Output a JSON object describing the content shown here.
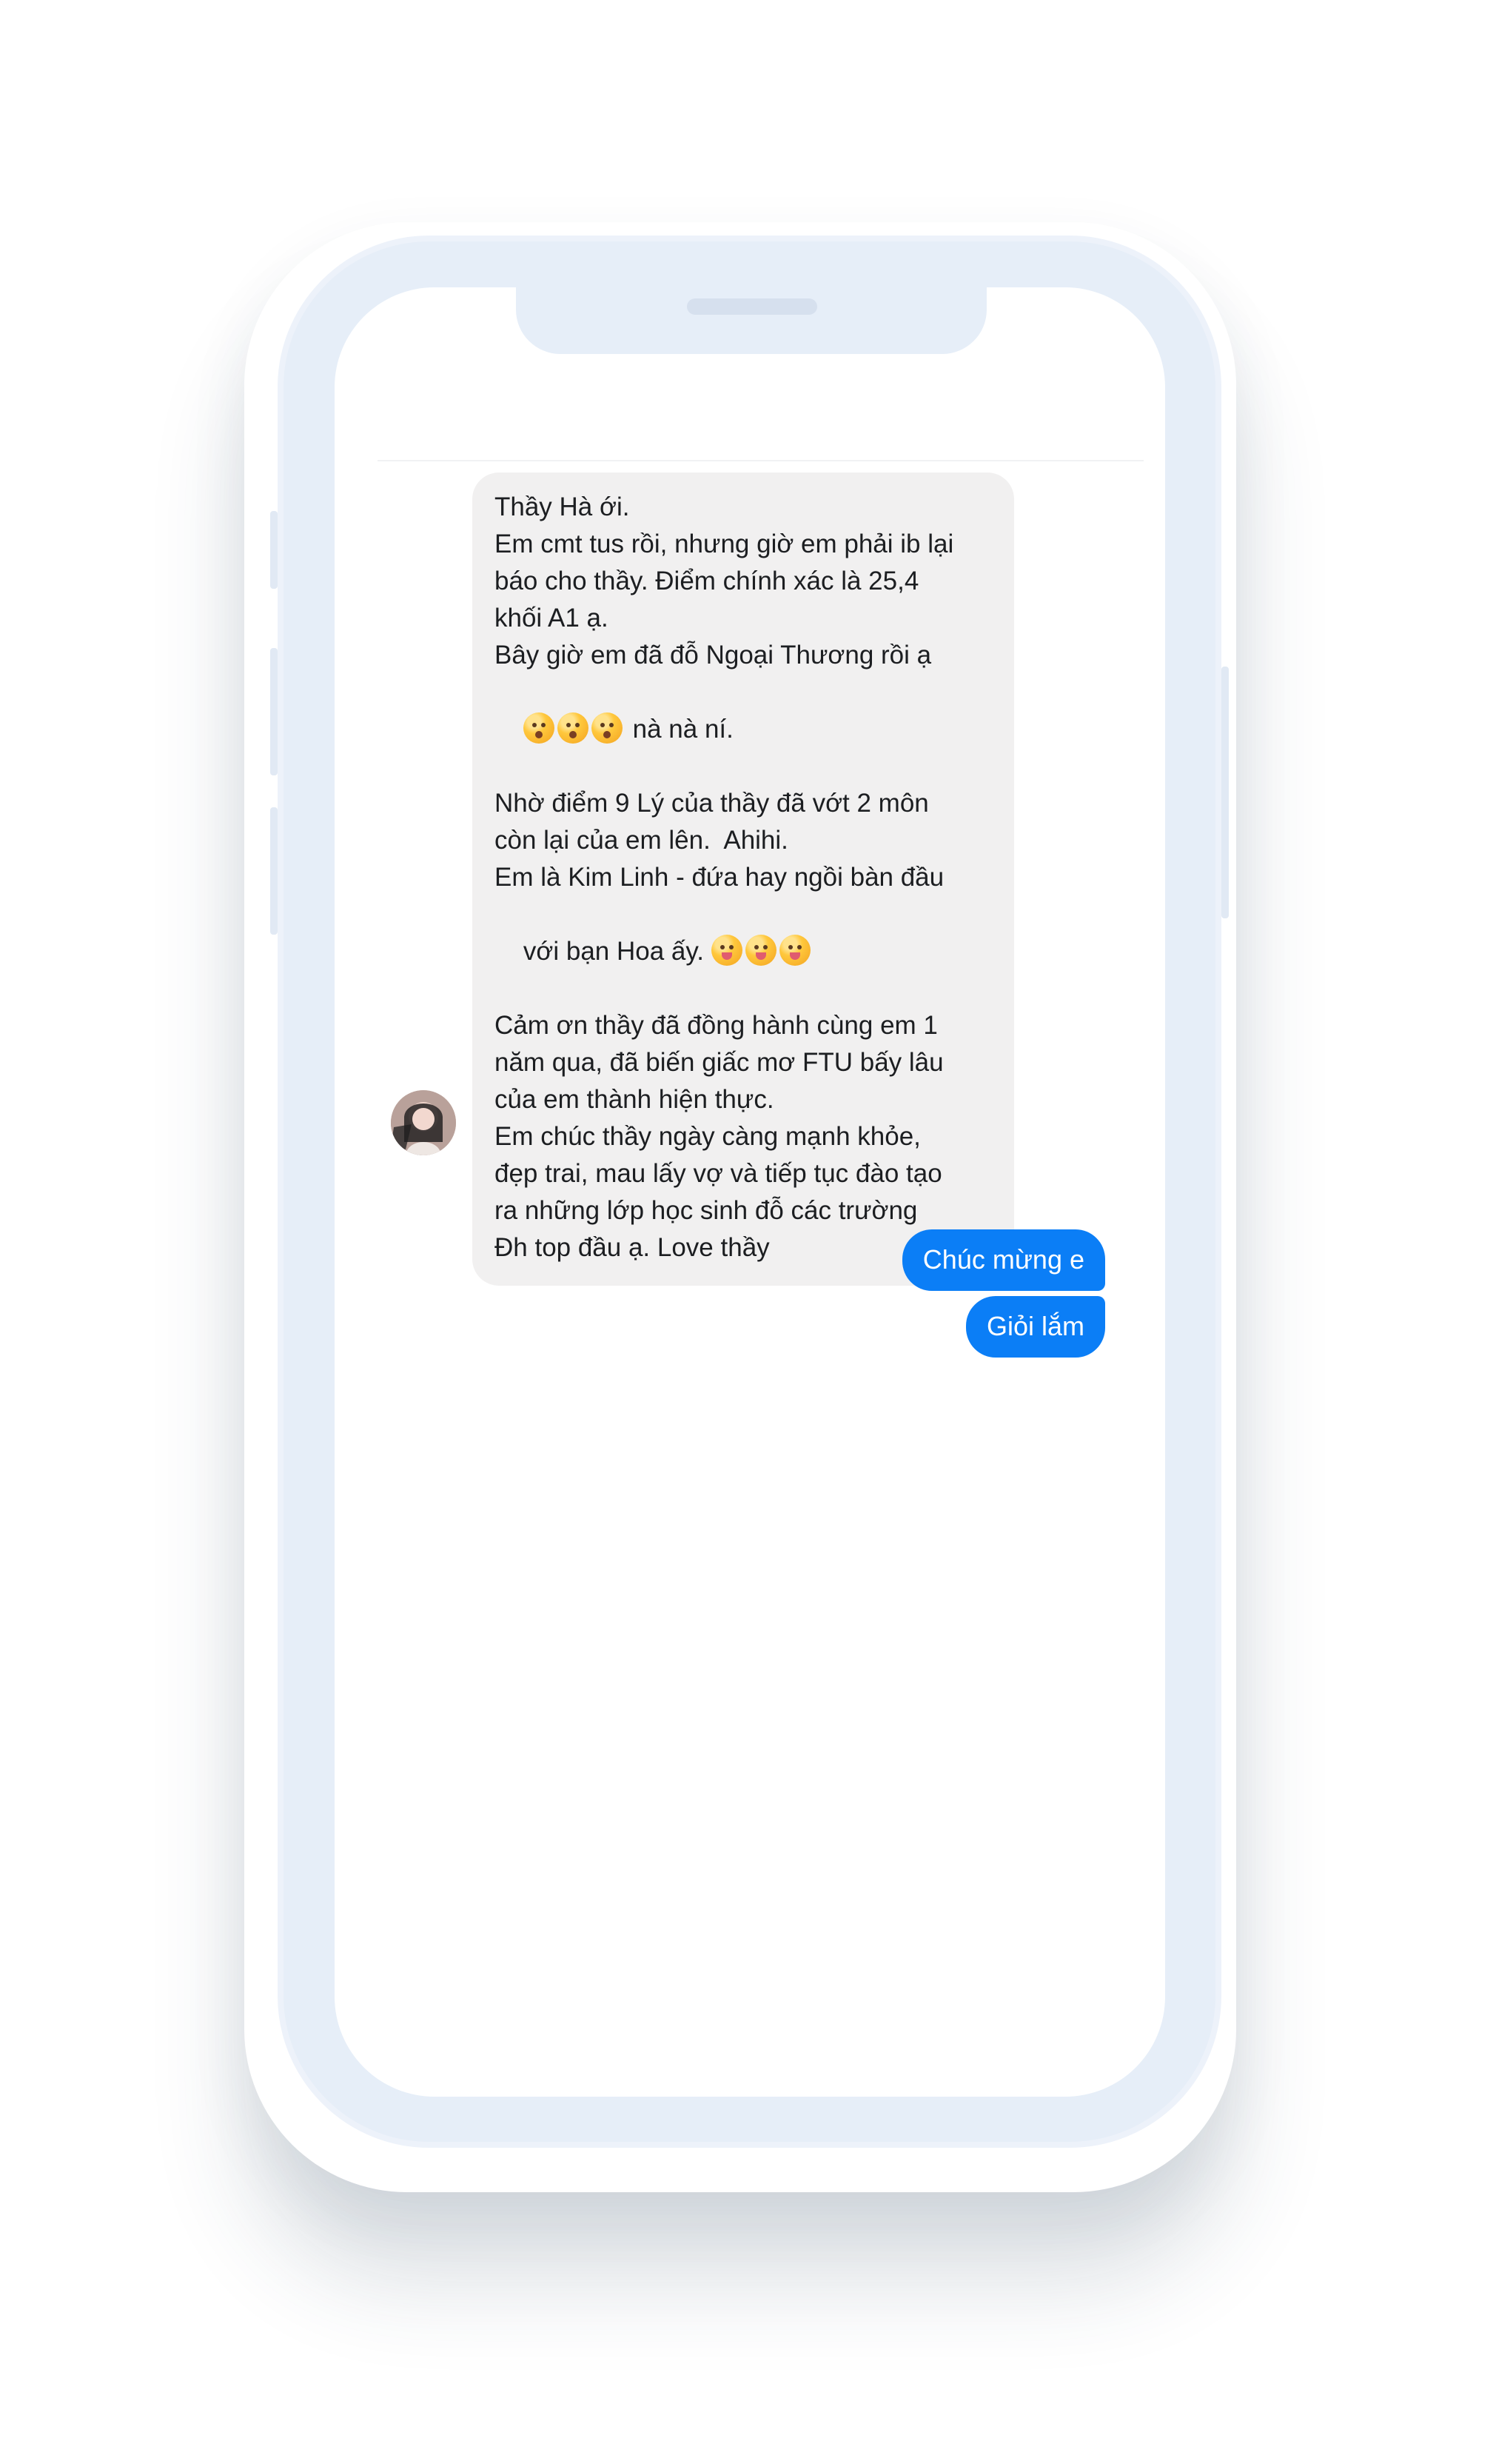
{
  "conversation": {
    "incoming_message": {
      "lines": [
        "Thầy Hà ới.",
        "Em cmt tus rồi, nhưng giờ em phải ib lại",
        "báo cho thầy. Điểm chính xác là 25,4",
        "khối A1 ạ.",
        "Bây giờ em đã đỗ Ngoại Thương rồi ạ",
        " nà nà ní.",
        "Nhờ điểm 9 Lý của thầy đã vớt 2 môn",
        "còn lại của em lên.  Ahihi.",
        "Em là Kim Linh - đứa hay ngồi bàn đầu",
        "với bạn Hoa ấy. ",
        "Cảm ơn thầy đã đồng hành cùng em 1",
        "năm qua, đã biến giấc mơ FTU bấy lâu",
        "của em thành hiện thực.",
        "Em chúc thầy ngày càng mạnh khỏe,",
        "đẹp trai, mau lấy vợ và tiếp tục đào tạo",
        "ra những lớp học sinh đỗ các trường",
        "Đh top đầu ạ. Love thầy"
      ]
    },
    "outgoing_messages": [
      "Chúc mừng e",
      "Giỏi lắm"
    ],
    "colors": {
      "incoming_bubble": "#f1f0f0",
      "outgoing_bubble": "#0b7ef6",
      "phone_frame": "#e6eef8"
    },
    "icons": {
      "avatar": "profile-avatar",
      "emoji_set_1": "kissing-face-icon",
      "emoji_set_2": "tongue-face-icon"
    }
  }
}
